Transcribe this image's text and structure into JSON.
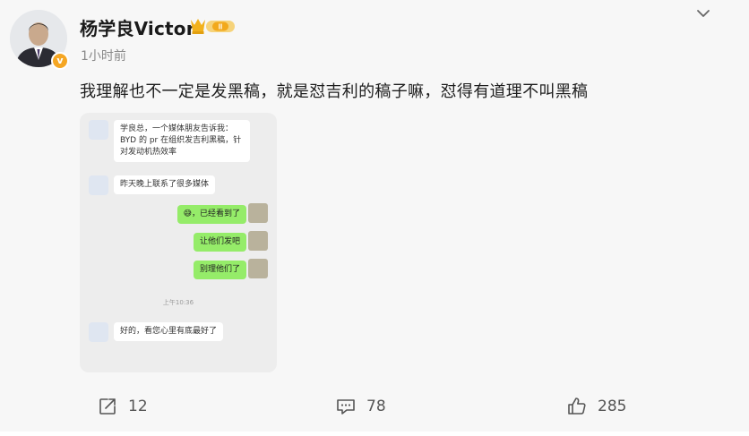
{
  "post": {
    "author": "杨学良Victor",
    "vip_level": "II",
    "time": "1小时前",
    "text": "我理解也不一定是发黑稿，就是怼吉利的稿子嘛，怼得有道理不叫黑稿",
    "verified_icon": "v-badge-orange",
    "more_icon": "chevron-down"
  },
  "chat": {
    "messages": [
      {
        "side": "left",
        "text": "学良总，一个媒体朋友告诉我：BYD 的 pr 在组织发吉利黑稿，针对发动机热效率"
      },
      {
        "side": "left",
        "text": "昨天晚上联系了很多媒体"
      },
      {
        "side": "right",
        "text": "😅，已经看到了"
      },
      {
        "side": "right",
        "text": "让他们发吧"
      },
      {
        "side": "right",
        "text": "别理他们了"
      },
      {
        "side": "left",
        "text": "好的，看您心里有底最好了"
      }
    ],
    "time_label": "上午10:36"
  },
  "actions": {
    "repost_count": "12",
    "comment_count": "78",
    "like_count": "285"
  },
  "colors": {
    "vip_gold": "#f5a623",
    "bubble_green": "#95ec69",
    "verify_orange": "#f5a623"
  }
}
